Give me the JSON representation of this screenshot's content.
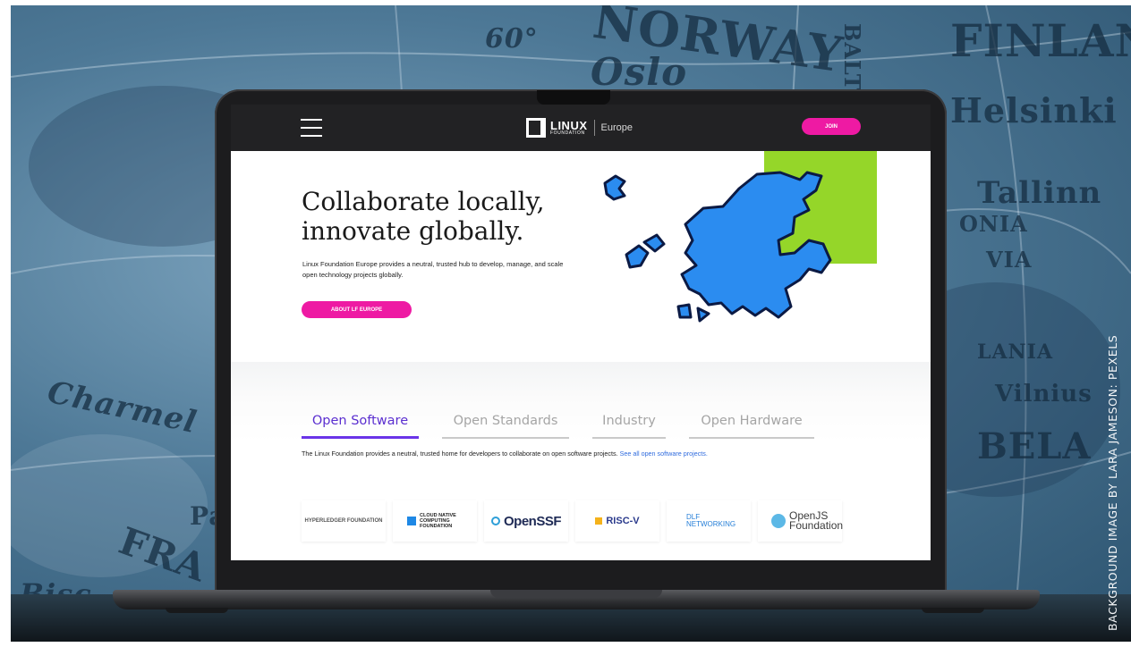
{
  "background": {
    "map_words": [
      "NORWAY",
      "Oslo",
      "FINLAND",
      "Helsinki",
      "Tallinn",
      "ONIA",
      "VIA",
      "Charmel",
      "FRA",
      "Bisc",
      "Pa",
      "BALTIC",
      "LANIA",
      "BELA",
      "Vilnius",
      "60°"
    ],
    "credit": "BACKGROUND IMAGE BY LARA JAMESON: PEXELS"
  },
  "nav": {
    "logo_brand": "LINUX",
    "logo_sub": "FOUNDATION",
    "logo_region": "Europe",
    "join_label": "JOIN"
  },
  "hero": {
    "title": "Collaborate locally, innovate globally.",
    "description": "Linux Foundation Europe provides a neutral, trusted hub to develop, manage, and scale open technology projects globally.",
    "cta_label": "ABOUT LF EUROPE"
  },
  "tabs": [
    {
      "label": "Open Software",
      "active": true
    },
    {
      "label": "Open Standards",
      "active": false
    },
    {
      "label": "Industry",
      "active": false
    },
    {
      "label": "Open Hardware",
      "active": false
    }
  ],
  "tab_content": {
    "text": "The Linux Foundation provides a neutral, trusted home for developers to collaborate on open software projects. ",
    "link": "See all open software projects."
  },
  "members": [
    {
      "name": "HYPERLEDGER FOUNDATION"
    },
    {
      "name": "CLOUD NATIVE COMPUTING FOUNDATION"
    },
    {
      "name": "OpenSSF"
    },
    {
      "name": "RISC-V"
    },
    {
      "name": "DLF NETWORKING"
    },
    {
      "name": "OpenJS Foundation"
    }
  ],
  "colors": {
    "accent_pink": "#ee1aa3",
    "tab_purple": "#6a34e8",
    "map_blue": "#2b8cf0",
    "green": "#95d629",
    "nav_dark": "#222224"
  }
}
